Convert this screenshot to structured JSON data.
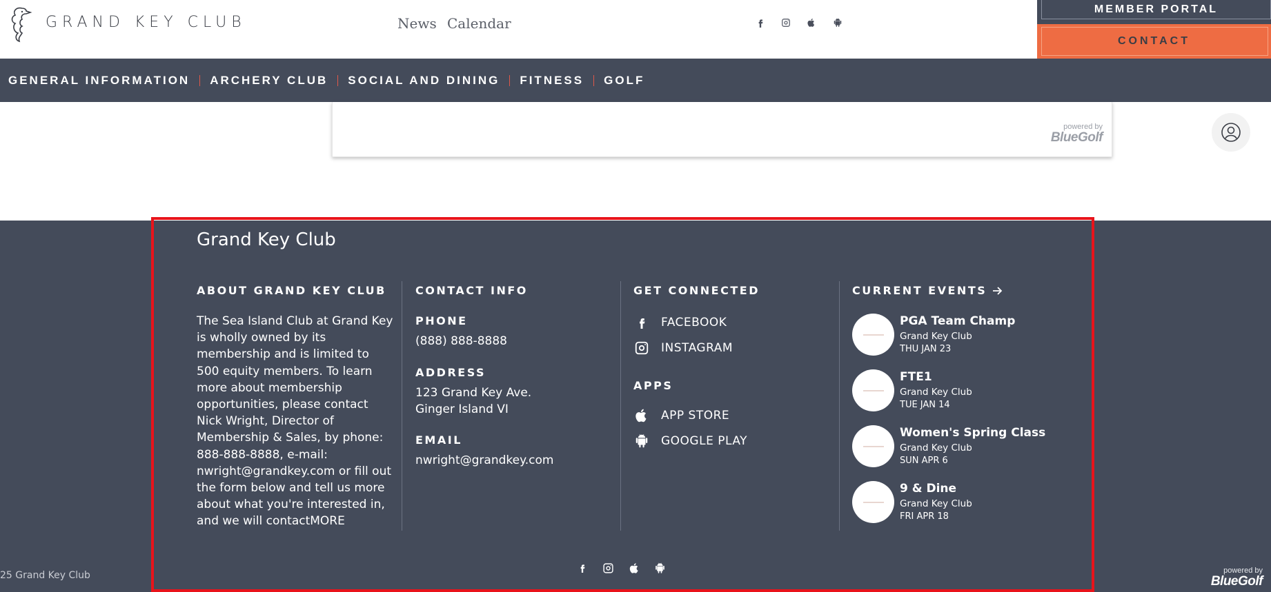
{
  "header": {
    "logo_text": "GRAND KEY CLUB",
    "links": [
      {
        "label": "News"
      },
      {
        "label": "Calendar"
      }
    ],
    "social_icons": [
      "facebook-icon",
      "instagram-icon",
      "apple-icon",
      "android-icon"
    ],
    "member_portal_label": "MEMBER PORTAL",
    "contact_label": "CONTACT"
  },
  "nav": {
    "items": [
      {
        "label": "GENERAL INFORMATION"
      },
      {
        "label": "ARCHERY CLUB"
      },
      {
        "label": "SOCIAL AND DINING"
      },
      {
        "label": "FITNESS"
      },
      {
        "label": "GOLF"
      }
    ]
  },
  "content": {
    "powered_by": "powered by",
    "brand": "BlueGolf"
  },
  "footer": {
    "title": "Grand Key Club",
    "about": {
      "heading": "ABOUT GRAND KEY CLUB",
      "text": "The Sea Island Club at Grand Key is wholly owned by its membership and is limited to 500 equity members. To learn more about membership opportunities, please contact Nick Wright, Director of Membership & Sales, by phone: 888-888-8888, e-mail: nwright@grandkey.com or fill out the form below and tell us more about what you're interested in, and we will contact",
      "more_label": "MORE"
    },
    "contact": {
      "heading": "CONTACT INFO",
      "phone_label": "PHONE",
      "phone": "(888) 888-8888",
      "address_label": "ADDRESS",
      "address_line1": "123 Grand Key Ave.",
      "address_line2": "Ginger Island VI",
      "email_label": "EMAIL",
      "email": "nwright@grandkey.com"
    },
    "connected": {
      "heading": "GET CONNECTED",
      "social": [
        {
          "label": "FACEBOOK",
          "icon": "facebook-icon"
        },
        {
          "label": "INSTAGRAM",
          "icon": "instagram-icon"
        }
      ],
      "apps_heading": "APPS",
      "apps": [
        {
          "label": "APP STORE",
          "icon": "apple-icon"
        },
        {
          "label": "GOOGLE PLAY",
          "icon": "android-icon"
        }
      ]
    },
    "events": {
      "heading": "CURRENT EVENTS",
      "items": [
        {
          "name": "PGA Team Champ",
          "org": "Grand Key Club",
          "date": "THU JAN 23"
        },
        {
          "name": "FTE1",
          "org": "Grand Key Club",
          "date": "TUE JAN 14"
        },
        {
          "name": "Women's Spring Class",
          "org": "Grand Key Club",
          "date": "SUN APR 6"
        },
        {
          "name": "9 & Dine",
          "org": "Grand Key Club",
          "date": "FRI APR 18"
        }
      ]
    },
    "bottom_icons": [
      "facebook-icon",
      "instagram-icon",
      "apple-icon",
      "android-icon"
    ],
    "copyright": "25 Grand Key Club",
    "powered_by": "powered by",
    "brand": "BlueGolf"
  },
  "colors": {
    "navy": "#444b5a",
    "accent_orange": "#ee6c43",
    "nav_separator": "#e0584a",
    "highlight_border": "#e8141b"
  }
}
